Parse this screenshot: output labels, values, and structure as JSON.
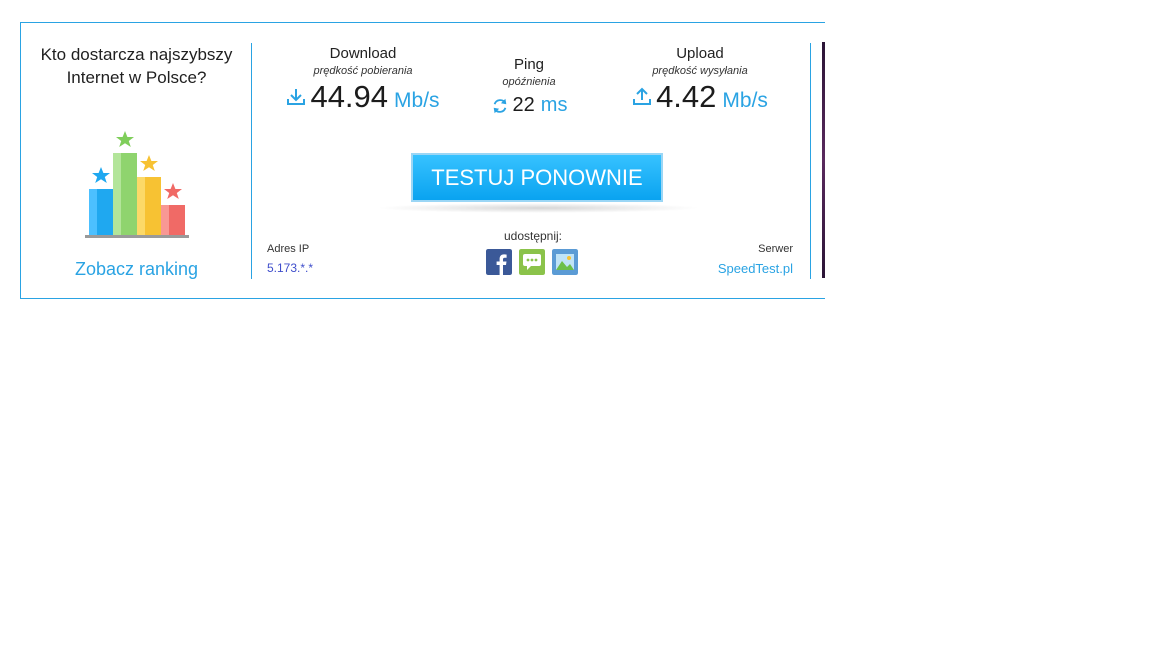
{
  "left_panel": {
    "question": "Kto dostarcza najszybszy Internet w Polsce?",
    "ranking_link": "Zobacz ranking"
  },
  "download": {
    "title": "Download",
    "subtitle": "prędkość pobierania",
    "value": "44.94",
    "unit": "Mb/s"
  },
  "ping": {
    "title": "Ping",
    "subtitle": "opóźnienia",
    "value": "22",
    "unit": "ms"
  },
  "upload": {
    "title": "Upload",
    "subtitle": "prędkość wysyłania",
    "value": "4.42",
    "unit": "Mb/s"
  },
  "test_button": "TESTUJ PONOWNIE",
  "ip": {
    "label": "Adres IP",
    "value": "5.173.*.*"
  },
  "share": {
    "label": "udostępnij:"
  },
  "server": {
    "label": "Serwer",
    "value": "SpeedTest.pl"
  },
  "colors": {
    "accent": "#2aa3e3",
    "button": "#1ab2f8",
    "facebook": "#3b5998",
    "sms": "#8bc34a",
    "image": "#5b9bd5"
  }
}
